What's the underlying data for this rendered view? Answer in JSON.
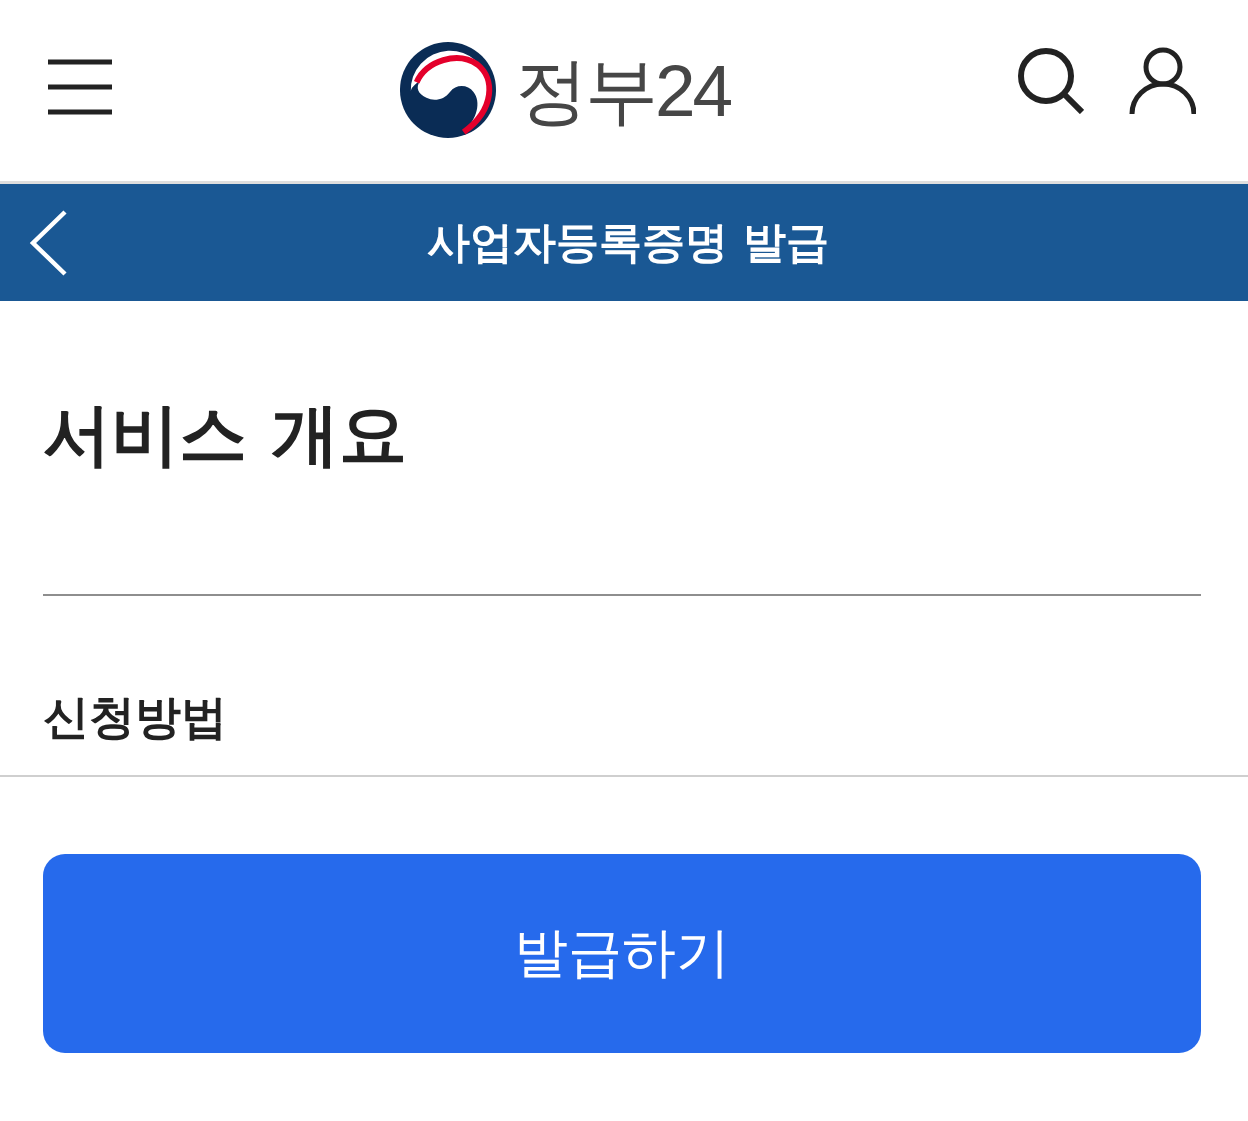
{
  "header": {
    "logo_text": "정부24"
  },
  "title_bar": {
    "title": "사업자등록증명 발급"
  },
  "overview": {
    "heading": "서비스 개요"
  },
  "apply_method": {
    "heading": "신청방법"
  },
  "issue_button": {
    "label": "발급하기"
  }
}
